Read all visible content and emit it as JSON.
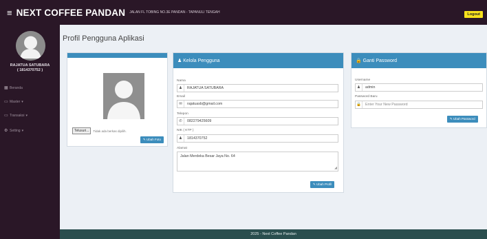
{
  "header": {
    "menu_icon": "≡",
    "app_name": "NEXT COFFEE PANDAN",
    "address": "JALAN FL TOBING NO.3E PANDAN - TAPANULI TENGAH",
    "logout_label": "Logout"
  },
  "sidebar": {
    "user_name": "RAJATUA SATUBARA",
    "user_id": "( 1814370752 )",
    "items": [
      {
        "label": "Beranda",
        "icon": "dashboard-icon",
        "glyph": "▦"
      },
      {
        "label": "Master",
        "icon": "laptop-icon",
        "glyph": "▭",
        "caret": "▾"
      },
      {
        "label": "Transaksi",
        "icon": "laptop-icon",
        "glyph": "▭",
        "caret": "▾"
      },
      {
        "label": "Setting",
        "icon": "gear-icon",
        "glyph": "⚙",
        "caret": "▾"
      }
    ]
  },
  "page": {
    "title": "Profil Pengguna Aplikasi"
  },
  "photo_card": {
    "file_button": "Telusuri...",
    "file_status": "Tidak ada berkas dipilih.",
    "upload_button": "✎ Ubah Foto"
  },
  "kelola_card": {
    "title": "♟ Kelola Pengguna",
    "fields": {
      "nama": {
        "label": "Nama",
        "value": "RAJATUA SATUBARA",
        "icon": "user-icon",
        "glyph": "♟"
      },
      "email": {
        "label": "Email",
        "value": "rajatuasb@gmail.com",
        "icon": "envelope-icon",
        "glyph": "✉"
      },
      "telepon": {
        "label": "Telepon",
        "value": "082279425609",
        "icon": "phone-icon",
        "glyph": "✆"
      },
      "nik": {
        "label": "NIK ( KTP )",
        "value": "1814370752",
        "icon": "user-icon",
        "glyph": "♟"
      },
      "alamat": {
        "label": "Alamat",
        "value": "Jalan Merdeka Besar Jaya No. 64"
      }
    },
    "submit_button": "✎ Ubah Profil"
  },
  "password_card": {
    "title": "🔒 Ganti Password",
    "username_label": "Username",
    "username_value": "admin",
    "username_icon": "♟",
    "password_label": "Password Baru",
    "password_placeholder": "Enter Your New Password",
    "password_icon": "🔒",
    "submit_button": "✎ Ubah Password"
  },
  "footer": {
    "text": "2025 - Next Coffee Pandan"
  }
}
